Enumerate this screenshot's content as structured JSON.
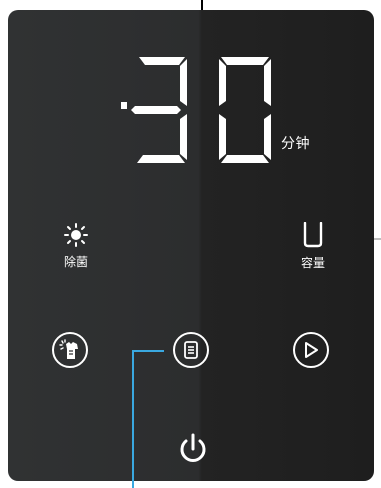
{
  "display": {
    "timer_value": "30",
    "timer_unit": "分钟"
  },
  "indicators": {
    "sterilize_label": "除菌",
    "capacity_label": "容量"
  },
  "buttons": {
    "mode": "mode-button",
    "program": "program-button",
    "start": "start-button",
    "power": "power-button"
  },
  "colors": {
    "panel_light": "#303233",
    "panel_dark": "#1e1e1e",
    "glyph": "#ffffff",
    "callout_blue": "#3aa8e0"
  },
  "icons": {
    "sterilize": "sun-icon",
    "capacity": "bucket-icon",
    "mode": "shirt-spray-icon",
    "program": "list-icon",
    "start": "play-icon",
    "power": "power-icon"
  }
}
